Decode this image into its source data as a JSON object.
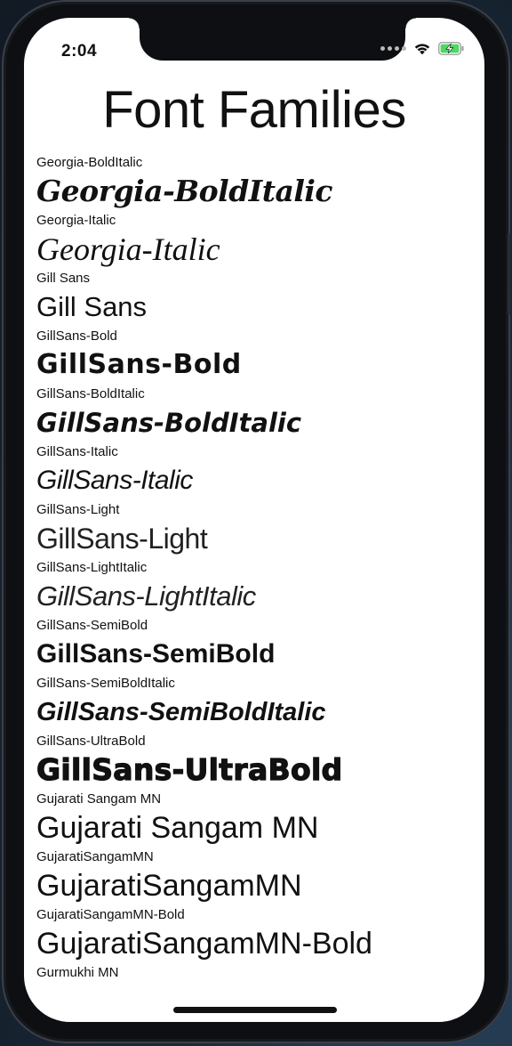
{
  "status_bar": {
    "time": "2:04",
    "signal_icon": "signal-dots-icon",
    "wifi_icon": "wifi-icon",
    "battery_icon": "battery-charging-icon",
    "battery_color": "#4cd964"
  },
  "title": "Font Families",
  "fonts": [
    {
      "label": "Georgia-BoldItalic",
      "sample": "Georgia-BoldItalic"
    },
    {
      "label": "Georgia-Italic",
      "sample": "Georgia-Italic"
    },
    {
      "label": "Gill Sans",
      "sample": "Gill Sans"
    },
    {
      "label": "GillSans-Bold",
      "sample": "GillSans-Bold"
    },
    {
      "label": "GillSans-BoldItalic",
      "sample": "GillSans-BoldItalic"
    },
    {
      "label": "GillSans-Italic",
      "sample": "GillSans-Italic"
    },
    {
      "label": "GillSans-Light",
      "sample": "GillSans-Light"
    },
    {
      "label": "GillSans-LightItalic",
      "sample": "GillSans-LightItalic"
    },
    {
      "label": "GillSans-SemiBold",
      "sample": "GillSans-SemiBold"
    },
    {
      "label": "GillSans-SemiBoldItalic",
      "sample": "GillSans-SemiBoldItalic"
    },
    {
      "label": "GillSans-UltraBold",
      "sample": "GillSans-UltraBold"
    },
    {
      "label": "Gujarati Sangam MN",
      "sample": "Gujarati Sangam MN"
    },
    {
      "label": "GujaratiSangamMN",
      "sample": "GujaratiSangamMN"
    },
    {
      "label": "GujaratiSangamMN-Bold",
      "sample": "GujaratiSangamMN-Bold"
    },
    {
      "label": "Gurmukhi MN",
      "sample": ""
    }
  ]
}
